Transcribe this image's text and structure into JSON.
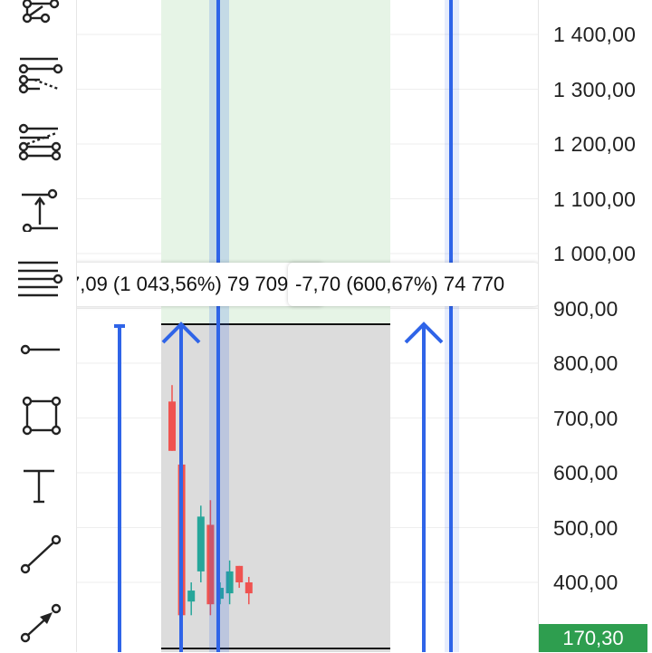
{
  "toolbar": {
    "tools": [
      {
        "icon": "node-graph-icon"
      },
      {
        "icon": "pitchfan-lines-icon"
      },
      {
        "icon": "fib-channel-icon"
      },
      {
        "icon": "vertical-measure-icon"
      },
      {
        "icon": "fib-retracement-icon"
      },
      {
        "icon": "ray-line-icon"
      },
      {
        "icon": "rectangle-icon"
      },
      {
        "icon": "text-tool-icon"
      },
      {
        "icon": "trend-line-icon"
      },
      {
        "icon": "arrow-line-icon"
      }
    ]
  },
  "price_axis": {
    "ticks": [
      "1 400,00",
      "1 300,00",
      "1 200,00",
      "1 100,00",
      "1 000,00",
      "900,00",
      "800,00",
      "700,00",
      "600,00",
      "500,00",
      "400,00"
    ],
    "current_price": "170,30"
  },
  "callouts": [
    {
      "text": "7,09 (1 043,56%) 79 709"
    },
    {
      "text": "-7,70 (600,67%) 74 770"
    }
  ],
  "colors": {
    "accent_blue": "#2f64e8",
    "bullish": "#26a69a",
    "bearish": "#ef5350",
    "range_fill_green": "#e6f4e6",
    "range_fill_grey": "#dcdcdc",
    "price_label_bg": "#2e9e4f"
  },
  "chart_data": {
    "type": "candlestick",
    "ylim": [
      340,
      1430
    ],
    "y_ticks": [
      400,
      500,
      600,
      700,
      800,
      900,
      1000,
      1100,
      1200,
      1300,
      1400
    ],
    "current_price": 170.3,
    "candles": [
      {
        "open": 640,
        "close": 730,
        "high": 760,
        "low": 640,
        "dir": "down"
      },
      {
        "open": 340,
        "close": 615,
        "high": 615,
        "low": 340,
        "dir": "down"
      },
      {
        "open": 385,
        "close": 365,
        "high": 400,
        "low": 340,
        "dir": "up"
      },
      {
        "open": 420,
        "close": 520,
        "high": 540,
        "low": 400,
        "dir": "up"
      },
      {
        "open": 360,
        "close": 505,
        "high": 550,
        "low": 340,
        "dir": "down"
      },
      {
        "open": 370,
        "close": 390,
        "high": 400,
        "low": 360,
        "dir": "up"
      },
      {
        "open": 380,
        "close": 420,
        "high": 440,
        "low": 360,
        "dir": "up"
      },
      {
        "open": 430,
        "close": 400,
        "high": 430,
        "low": 390,
        "dir": "down"
      },
      {
        "open": 400,
        "close": 380,
        "high": 410,
        "low": 360,
        "dir": "down"
      }
    ]
  }
}
